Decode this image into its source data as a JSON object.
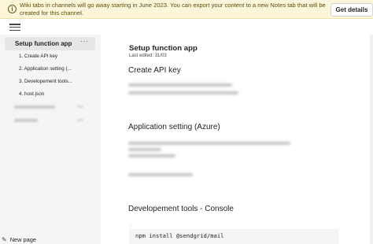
{
  "banner": {
    "icon": "info-icon",
    "message": "Wiki tabs in channels will go away starting in June 2023. You can export your content to a new Notes tab that will be created for this channel.",
    "button_label": "Get details"
  },
  "sidebar": {
    "menu_icon": "hamburger-icon",
    "active_page": {
      "label": "Setup function app",
      "more": "···"
    },
    "sub_items": [
      {
        "label": "1. Create API key"
      },
      {
        "label": "2. Application setting (..."
      },
      {
        "label": "3. Developement tools..."
      },
      {
        "label": "4. host.json"
      }
    ],
    "new_page": {
      "label": "New page",
      "icon": "new-page-icon"
    }
  },
  "content": {
    "title": "Setup function app",
    "last_edited": "Last edited: 31/03",
    "sections": [
      {
        "heading": "Create API key"
      },
      {
        "heading": "Application setting (Azure)"
      },
      {
        "heading": "Developement tools - Console"
      }
    ],
    "code": "npm install @sendgrid/mail"
  },
  "colors": {
    "banner_bg": "#fbf6d9",
    "sidebar_bg": "#f5f5f5",
    "active_item_bg": "#e6e6e6",
    "code_bg": "#f4f4f4"
  }
}
